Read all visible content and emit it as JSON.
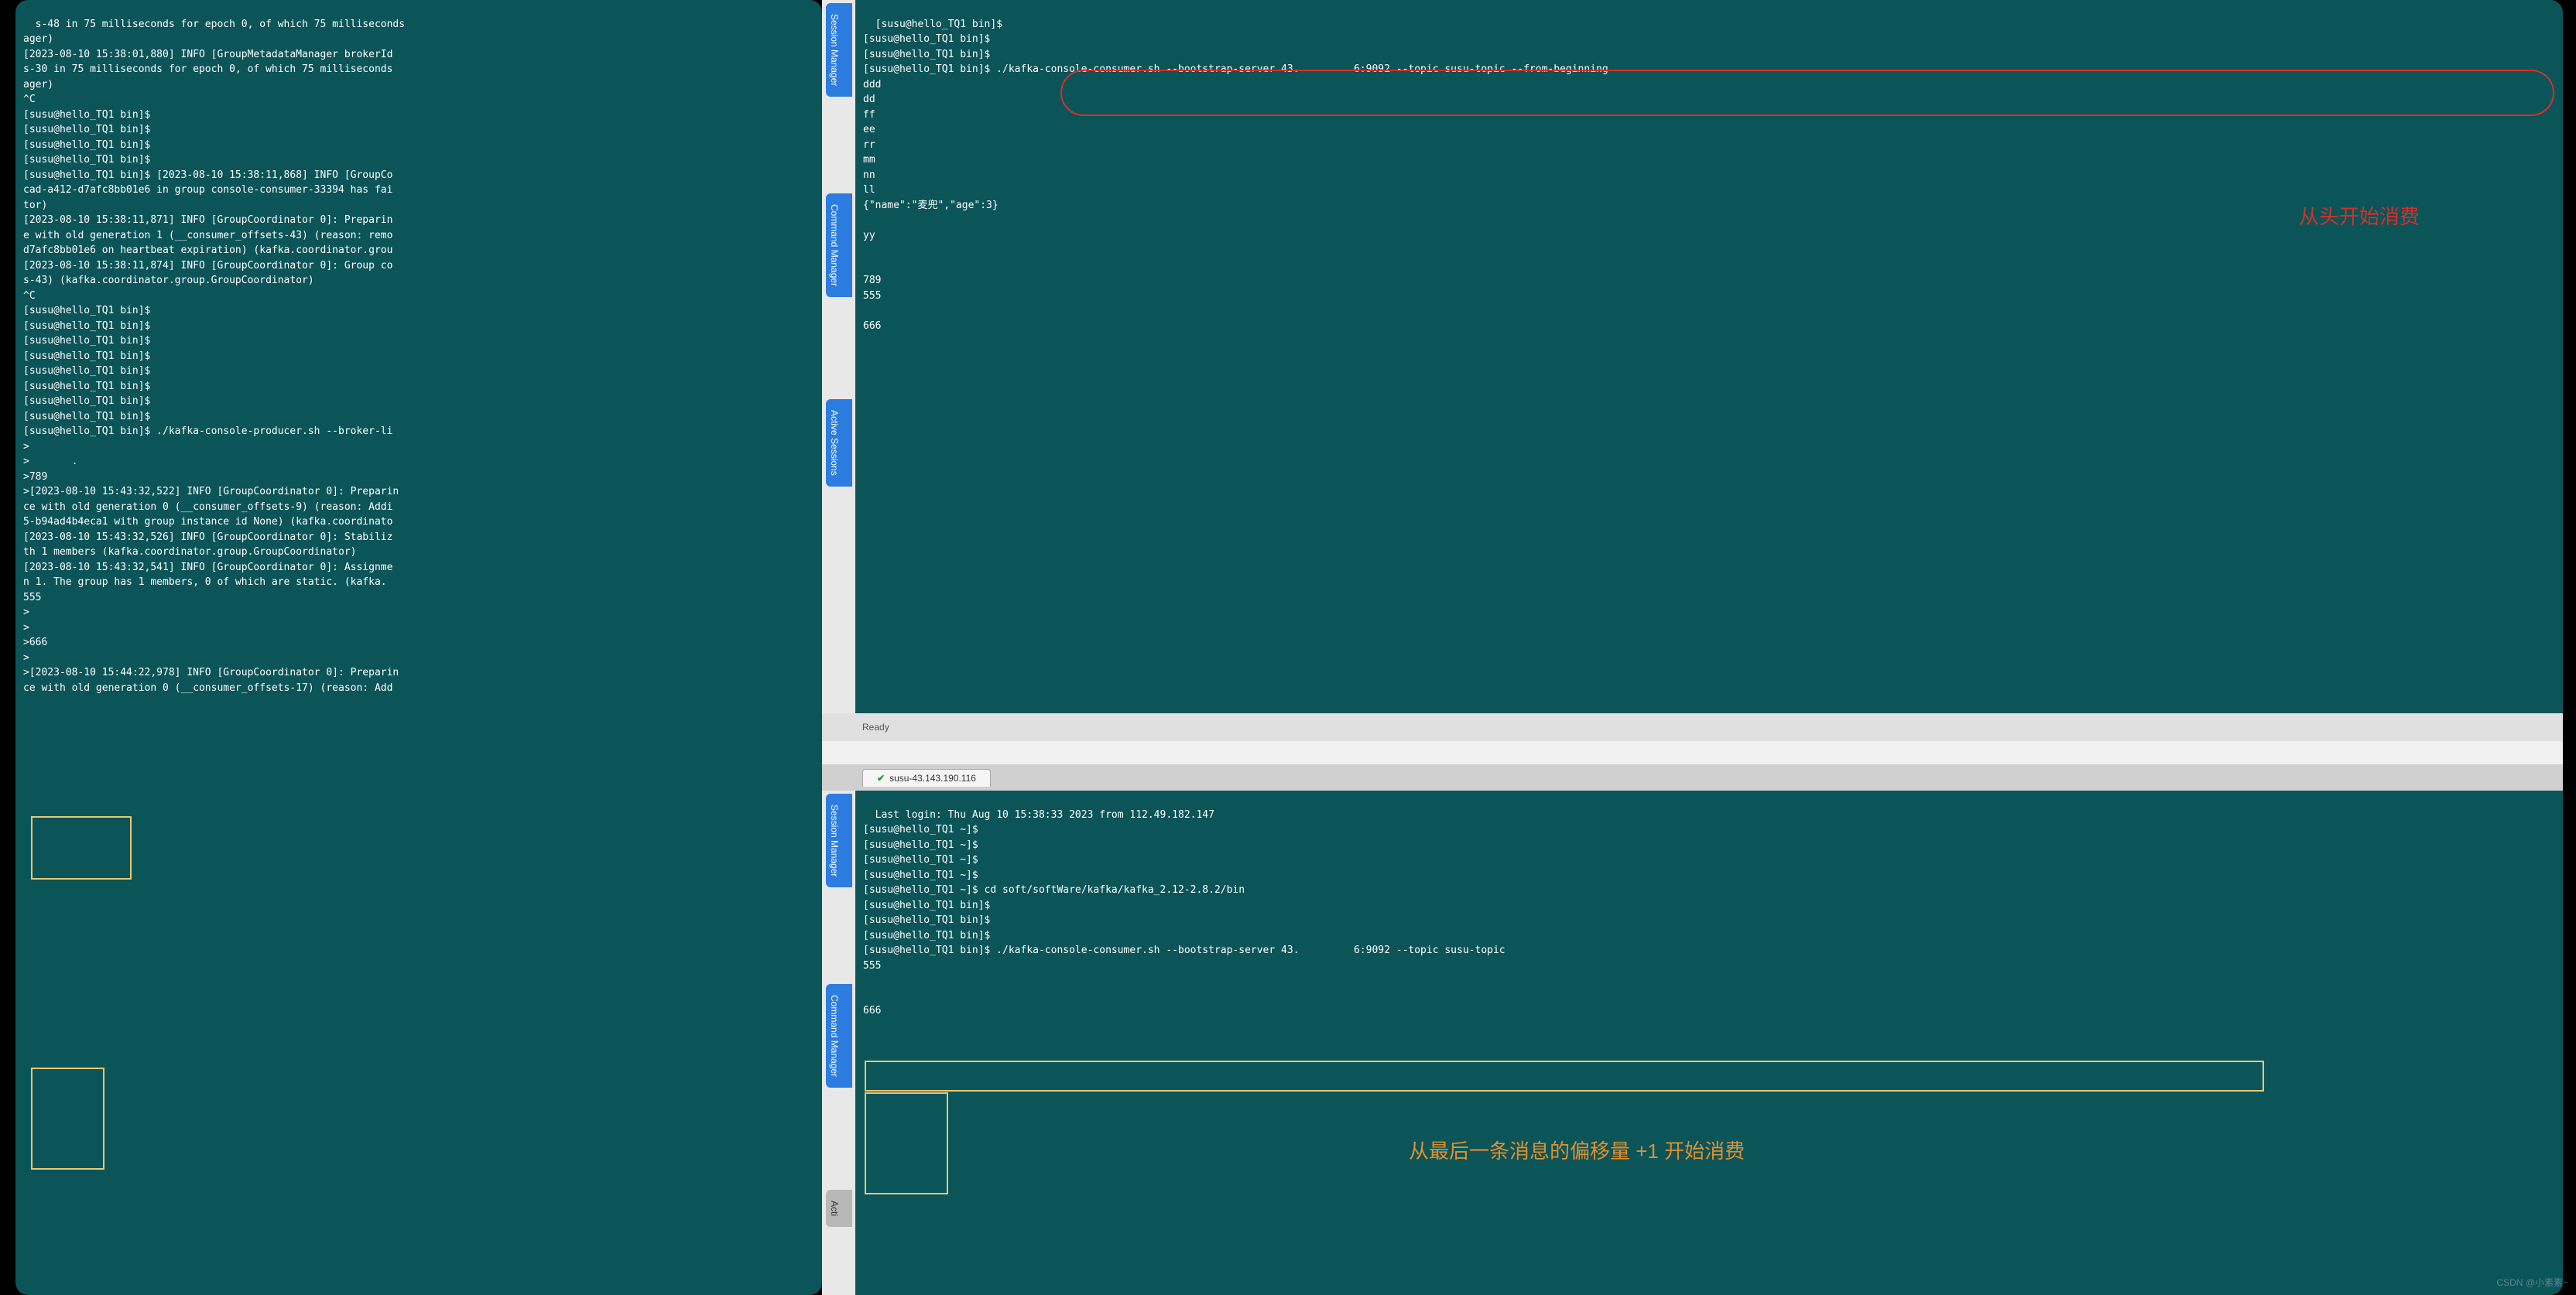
{
  "left_terminal": {
    "content": "s-48 in 75 milliseconds for epoch 0, of which 75 milliseconds\nager)\n[2023-08-10 15:38:01,880] INFO [GroupMetadataManager brokerId\ns-30 in 75 milliseconds for epoch 0, of which 75 milliseconds\nager)\n^C\n[susu@hello_TQ1 bin]$\n[susu@hello_TQ1 bin]$\n[susu@hello_TQ1 bin]$\n[susu@hello_TQ1 bin]$\n[susu@hello_TQ1 bin]$ [2023-08-10 15:38:11,868] INFO [GroupCo\ncad-a412-d7afc8bb01e6 in group console-consumer-33394 has fai\ntor)\n[2023-08-10 15:38:11,871] INFO [GroupCoordinator 0]: Preparin\ne with old generation 1 (__consumer_offsets-43) (reason: remo\nd7afc8bb01e6 on heartbeat expiration) (kafka.coordinator.grou\n[2023-08-10 15:38:11,874] INFO [GroupCoordinator 0]: Group co\ns-43) (kafka.coordinator.group.GroupCoordinator)\n^C\n[susu@hello_TQ1 bin]$\n[susu@hello_TQ1 bin]$\n[susu@hello_TQ1 bin]$\n[susu@hello_TQ1 bin]$\n[susu@hello_TQ1 bin]$\n[susu@hello_TQ1 bin]$\n[susu@hello_TQ1 bin]$\n[susu@hello_TQ1 bin]$\n[susu@hello_TQ1 bin]$ ./kafka-console-producer.sh --broker-li\n>\n>       .\n>789\n>[2023-08-10 15:43:32,522] INFO [GroupCoordinator 0]: Preparin\nce with old generation 0 (__consumer_offsets-9) (reason: Addi\n5-b94ad4b4eca1 with group instance id None) (kafka.coordinato\n[2023-08-10 15:43:32,526] INFO [GroupCoordinator 0]: Stabiliz\nth 1 members (kafka.coordinator.group.GroupCoordinator)\n[2023-08-10 15:43:32,541] INFO [GroupCoordinator 0]: Assignme\nn 1. The group has 1 members, 0 of which are static. (kafka.\n555\n>\n>\n>666\n>\n>[2023-08-10 15:44:22,978] INFO [GroupCoordinator 0]: Preparin\nce with old generation 0 (__consumer_offsets-17) (reason: Add"
  },
  "right_top_terminal": {
    "content": "[susu@hello_TQ1 bin]$\n[susu@hello_TQ1 bin]$\n[susu@hello_TQ1 bin]$\n[susu@hello_TQ1 bin]$ ./kafka-console-consumer.sh --bootstrap-server 43.         6:9092 --topic susu-topic --from-beginning\nddd\ndd\nff\nee\nrr\nmm\nnn\nll\n{\"name\":\"麦兜\",\"age\":3}\n\nyy\n\n\n789\n555\n\n666"
  },
  "right_bottom_terminal": {
    "content": "Last login: Thu Aug 10 15:38:33 2023 from 112.49.182.147\n[susu@hello_TQ1 ~]$\n[susu@hello_TQ1 ~]$\n[susu@hello_TQ1 ~]$\n[susu@hello_TQ1 ~]$\n[susu@hello_TQ1 ~]$ cd soft/softWare/kafka/kafka_2.12-2.8.2/bin\n[susu@hello_TQ1 bin]$\n[susu@hello_TQ1 bin]$\n[susu@hello_TQ1 bin]$\n[susu@hello_TQ1 bin]$ ./kafka-console-consumer.sh --bootstrap-server 43.         6:9092 --topic susu-topic\n555\n\n\n666"
  },
  "status": {
    "text": "Ready"
  },
  "tab": {
    "label": "susu-43.143.190.116"
  },
  "vtabs_left": {
    "session_manager": "Session Manager",
    "command_manager": "Command Manager",
    "active_sessions": "Active Sessions"
  },
  "vtabs_right": {
    "session_manager": "Session Manager",
    "command_manager": "Command Manager",
    "acti": "Acti"
  },
  "annotations": {
    "red_top": "从头开始消费",
    "orange_bottom": "从最后一条消息的偏移量 +1 开始消费"
  },
  "watermark": "CSDN @小素素~"
}
